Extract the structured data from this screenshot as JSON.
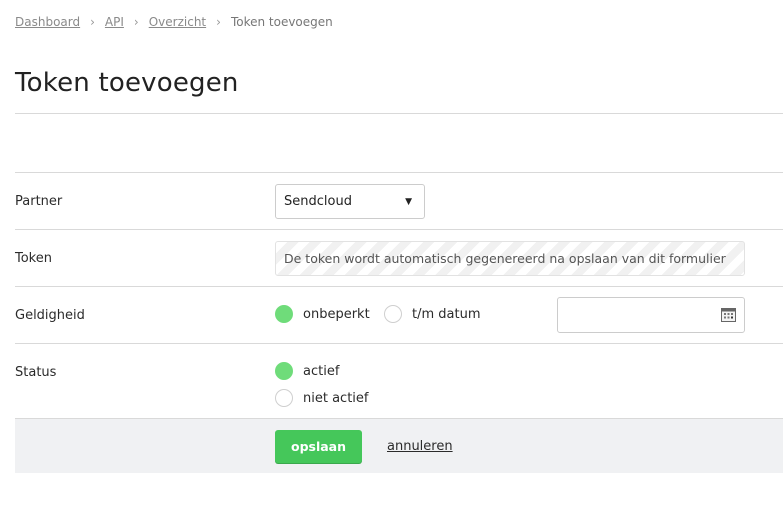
{
  "breadcrumb": {
    "items": [
      "Dashboard",
      "API",
      "Overzicht"
    ],
    "current": "Token toevoegen",
    "separator": "›"
  },
  "page": {
    "title": "Token toevoegen"
  },
  "form": {
    "partner": {
      "label": "Partner",
      "selected": "Sendcloud"
    },
    "token": {
      "label": "Token",
      "text": "De token wordt automatisch gegenereerd na opslaan van dit formulier"
    },
    "validity": {
      "label": "Geldigheid",
      "options": [
        "onbeperkt",
        "t/m datum"
      ],
      "selected": "onbeperkt",
      "date_value": ""
    },
    "status": {
      "label": "Status",
      "options": [
        "actief",
        "niet actief"
      ],
      "selected": "actief"
    }
  },
  "actions": {
    "save_label": "opslaan",
    "cancel_label": "annuleren"
  },
  "colors": {
    "accent": "#45c75a",
    "radio_on": "#6fdc7a"
  }
}
